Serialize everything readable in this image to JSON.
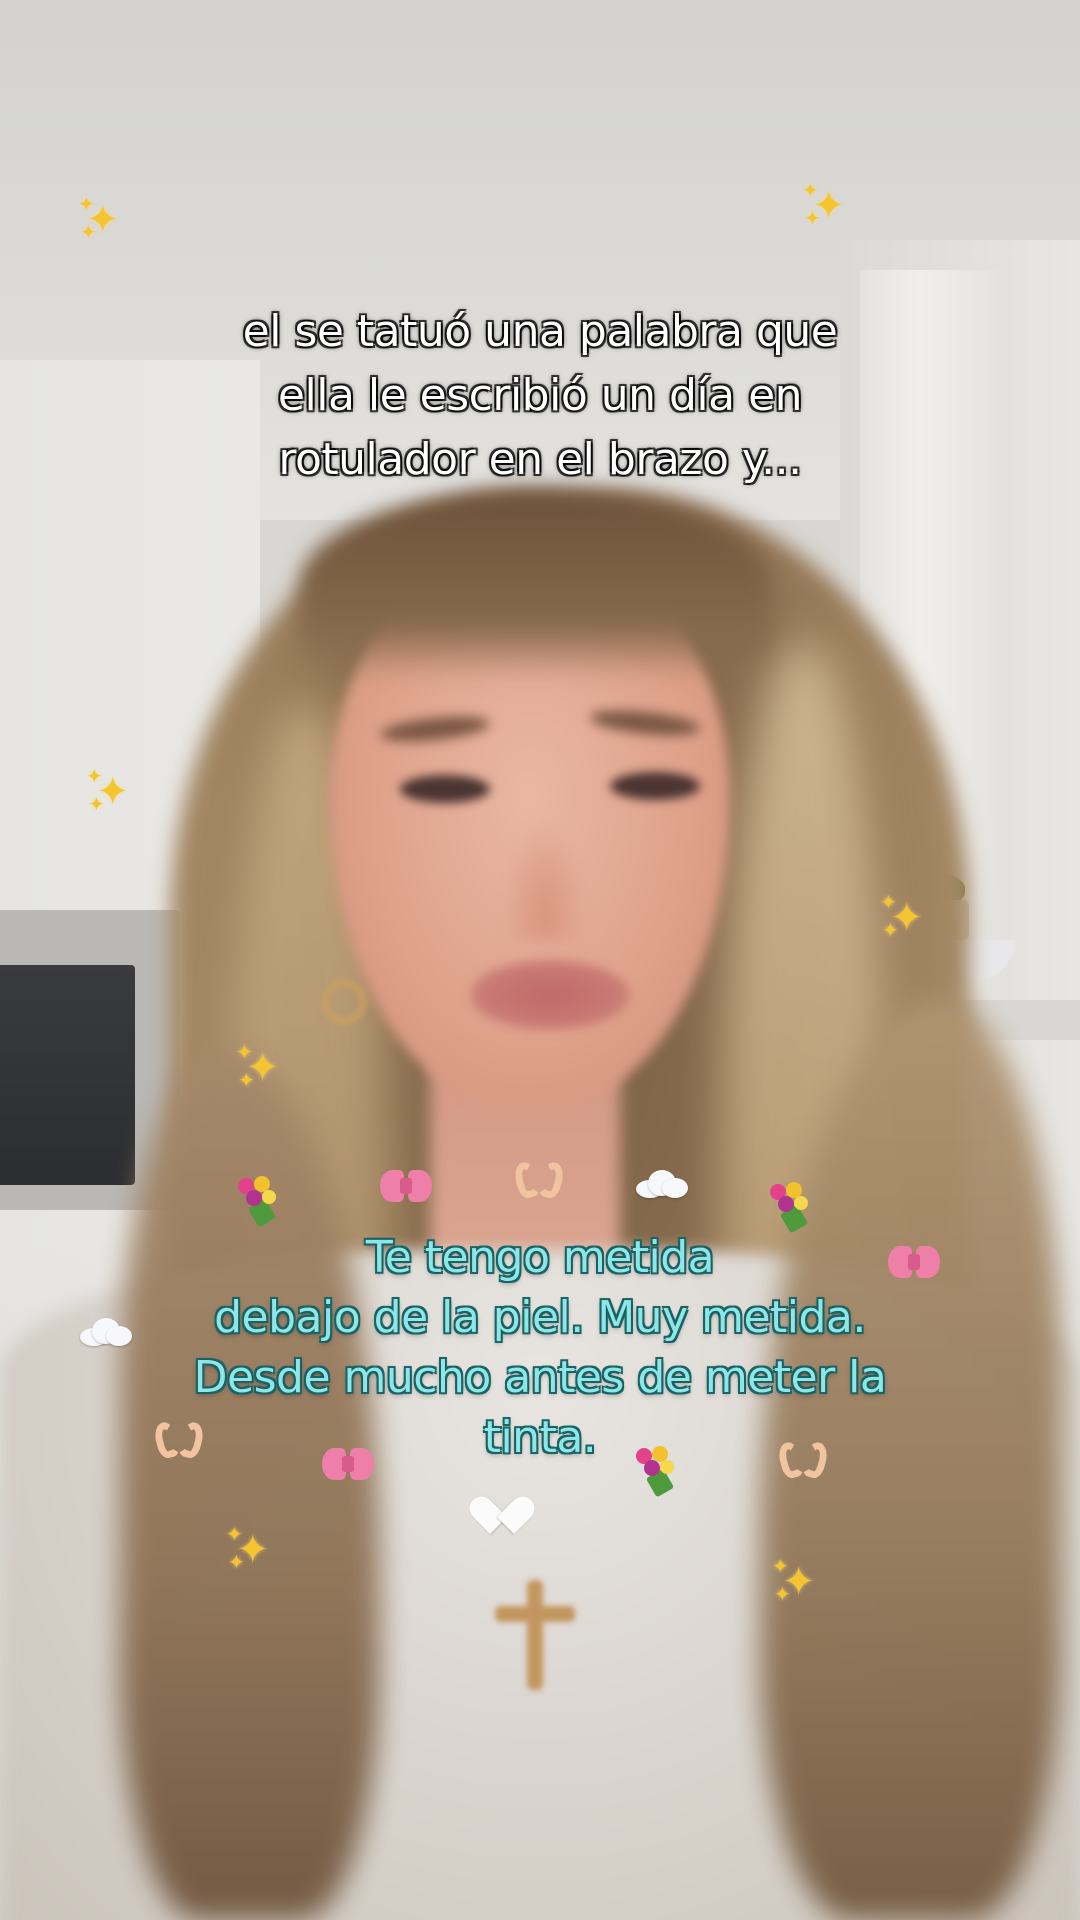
{
  "captions": {
    "top_lines": [
      "el se tatuó una palabra que",
      "ella le escribió un día en",
      "rotulador en el brazo y..."
    ],
    "middle_lines": [
      "Te tengo metida",
      "debajo de la piel. Muy metida.",
      "Desde mucho antes de meter la",
      "tinta."
    ]
  },
  "stickers": {
    "sparkle": "sparkles-icon",
    "bow": "ribbon-icon",
    "cloud": "cloud-icon",
    "hands": "heart-hands-icon",
    "bouquet": "bouquet-icon",
    "heart": "white-heart-icon"
  },
  "colors": {
    "top_caption_text": "#ffffff",
    "middle_caption_text": "#8fe6e6",
    "middle_caption_outline": "#1d6567",
    "sparkle": "#f5c531",
    "bow": "#ee7fa8"
  }
}
